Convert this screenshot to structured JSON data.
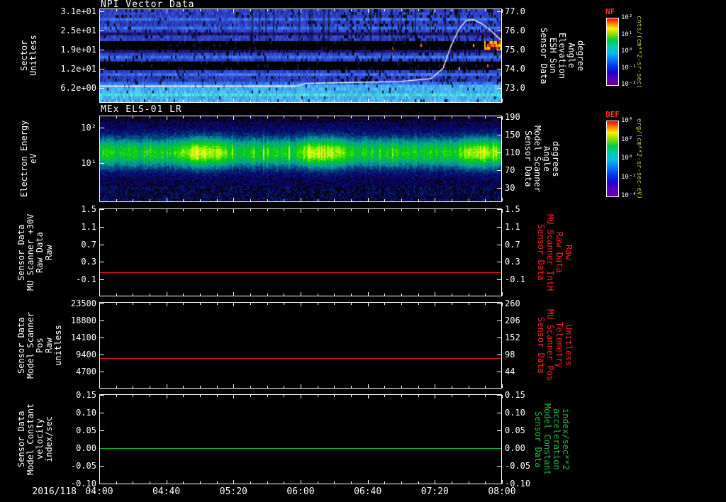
{
  "x_axis": {
    "date_label": "2016/118",
    "tick_labels": [
      "04:00",
      "04:40",
      "05:20",
      "06:00",
      "06:40",
      "07:20",
      "08:00"
    ],
    "range_hours": [
      4.0,
      8.0
    ]
  },
  "chart_data": [
    {
      "type": "heatmap",
      "title": "NPI Vector Data",
      "ylabel": "Sector\nUnitless",
      "y_ticks": [
        {
          "label": "3.1e+01",
          "frac": 0.03
        },
        {
          "label": "2.5e+01",
          "frac": 0.233
        },
        {
          "label": "1.9e+01",
          "frac": 0.436
        },
        {
          "label": "1.2e+01",
          "frac": 0.639
        },
        {
          "label": "6.2e+00",
          "frac": 0.842
        }
      ],
      "y2label": "Sensor Data\nESH Sun\nElevation\nAngle\ndegree",
      "y2_range": [
        72.2,
        77.15
      ],
      "y2_ticks": [
        {
          "label": "77.0",
          "frac": 0.03
        },
        {
          "label": "76.0",
          "frac": 0.233
        },
        {
          "label": "75.0",
          "frac": 0.436
        },
        {
          "label": "74.0",
          "frac": 0.639
        },
        {
          "label": "73.0",
          "frac": 0.842
        }
      ],
      "colorbar": {
        "name": "NF",
        "units": "cnts/(cm**2-sr-sec)",
        "tick_labels": [
          "10²",
          "10¹",
          "10⁰",
          "10⁻¹",
          "10⁻²"
        ]
      },
      "heat_row_levels": [
        2,
        2,
        2,
        3,
        2,
        2,
        3,
        2,
        1,
        2,
        2,
        0,
        0,
        0,
        1,
        2,
        3,
        2,
        0,
        0,
        0,
        2,
        3,
        2,
        2,
        3,
        4,
        4,
        4,
        5,
        4,
        4
      ],
      "overlay_line": {
        "name": "ESH Sun Elevation Angle",
        "color": "#ffffff",
        "points_hour_deg": [
          [
            4.0,
            73.05
          ],
          [
            5.95,
            73.05
          ],
          [
            6.05,
            73.2
          ],
          [
            7.0,
            73.3
          ],
          [
            7.3,
            73.45
          ],
          [
            7.42,
            74.0
          ],
          [
            7.5,
            75.2
          ],
          [
            7.58,
            76.1
          ],
          [
            7.65,
            76.55
          ],
          [
            7.72,
            76.6
          ],
          [
            7.8,
            76.4
          ],
          [
            7.9,
            76.0
          ],
          [
            8.0,
            75.5
          ]
        ]
      }
    },
    {
      "type": "heatmap",
      "title": "MEx ELS-01 LR",
      "ylabel": "Electron Energy\neV",
      "y_ticks": [
        {
          "label": "10²",
          "frac": 0.139
        },
        {
          "label": "10¹",
          "frac": 0.549
        }
      ],
      "y2label": "Sensor Data\nModel Scanner\nAngle\ndegrees",
      "y2_ticks": [
        {
          "label": "190",
          "frac": 0.016
        },
        {
          "label": "150",
          "frac": 0.221
        },
        {
          "label": "110",
          "frac": 0.426
        },
        {
          "label": "70",
          "frac": 0.631
        },
        {
          "label": "30",
          "frac": 0.836
        }
      ],
      "colorbar": {
        "name": "DEF",
        "units": "erg/(cm**2-sr-sec-eV)",
        "tick_labels": [
          "10⁴",
          "10²",
          "10⁰",
          "10⁻²",
          "10⁻⁴"
        ]
      },
      "band": {
        "center_frac": 0.42,
        "sigma_frac": 0.17,
        "hot_x_fracs": [
          [
            0.17,
            0.34
          ],
          [
            0.48,
            0.63
          ],
          [
            0.88,
            1.0
          ]
        ]
      }
    },
    {
      "type": "line",
      "ylabel": "Sensor Data\nMU Scanner +30V\nRaw Data\nRaw",
      "y_ticks": [
        {
          "label": "1.5",
          "frac": 0.008
        },
        {
          "label": "1.1",
          "frac": 0.208
        },
        {
          "label": "0.7",
          "frac": 0.408
        },
        {
          "label": "0.3",
          "frac": 0.608
        },
        {
          "label": "-0.1",
          "frac": 0.808
        }
      ],
      "y2label": "Sensor Data\nMU Scanner IntH\nRaw Data\nRaw",
      "y2_ticks": [
        {
          "label": "1.5",
          "frac": 0.008
        },
        {
          "label": "1.1",
          "frac": 0.208
        },
        {
          "label": "0.7",
          "frac": 0.408
        },
        {
          "label": "0.3",
          "frac": 0.608
        },
        {
          "label": "-0.1",
          "frac": 0.808
        }
      ],
      "series": [
        {
          "name": "MU Scanner +30V Raw Data",
          "color": "#ee1111",
          "constant_value": 0.05,
          "frac": 0.725
        }
      ]
    },
    {
      "type": "line",
      "ylabel": "Sensor Data\nModel Scanner Pos\nRaw\nunitless",
      "y_ticks": [
        {
          "label": "23500",
          "frac": 0.016
        },
        {
          "label": "18800",
          "frac": 0.213
        },
        {
          "label": "14100",
          "frac": 0.41
        },
        {
          "label": "9400",
          "frac": 0.607
        },
        {
          "label": "4700",
          "frac": 0.803
        }
      ],
      "y2label": "Sensor Data\nMU Scanner Pos\nTelemetry\nUnitless",
      "y2_ticks": [
        {
          "label": "260",
          "frac": 0.016
        },
        {
          "label": "206",
          "frac": 0.213
        },
        {
          "label": "152",
          "frac": 0.41
        },
        {
          "label": "98",
          "frac": 0.607
        },
        {
          "label": "44",
          "frac": 0.803
        }
      ],
      "series": [
        {
          "name": "Model Scanner Pos Raw",
          "color": "#ee1111",
          "constant_value": 8500,
          "frac": 0.647
        }
      ]
    },
    {
      "type": "line",
      "ylabel": "Sensor Data\nModel Constant\nvelocity\nindex/sec",
      "y_ticks": [
        {
          "label": "0.15",
          "frac": 0.008
        },
        {
          "label": "0.10",
          "frac": 0.205
        },
        {
          "label": "0.05",
          "frac": 0.402
        },
        {
          "label": "0.00",
          "frac": 0.598
        },
        {
          "label": "-0.05",
          "frac": 0.795
        },
        {
          "label": "-0.10",
          "frac": 0.992
        }
      ],
      "y2label": "Sensor Data\nModel Constant\nacceleration\nindex/sec**2",
      "y2_ticks": [
        {
          "label": "0.15",
          "frac": 0.008
        },
        {
          "label": "0.10",
          "frac": 0.205
        },
        {
          "label": "0.05",
          "frac": 0.402
        },
        {
          "label": "0.00",
          "frac": 0.598
        },
        {
          "label": "-0.05",
          "frac": 0.795
        },
        {
          "label": "-0.10",
          "frac": 0.992
        }
      ],
      "series": [
        {
          "name": "Model Constant velocity",
          "color": "#00bb44",
          "constant_value": 0.0,
          "frac": 0.598
        }
      ]
    }
  ]
}
